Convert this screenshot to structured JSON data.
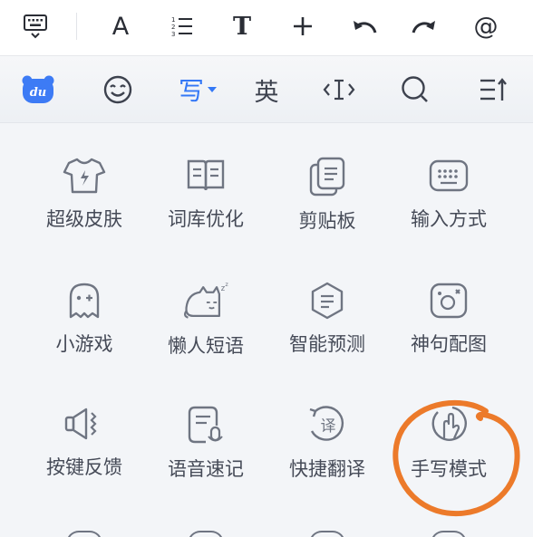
{
  "toolbar": {
    "font_glyph": "A",
    "text_glyph": "T",
    "tools": [
      "keyboard-icon",
      "font-icon",
      "numbered-list-icon",
      "text-icon",
      "add-icon",
      "undo-icon",
      "redo-icon",
      "at-icon"
    ],
    "at_glyph": "@"
  },
  "mode_bar": {
    "handwrite_label": "写",
    "english_label": "英"
  },
  "features": [
    {
      "label": "超级皮肤",
      "icon": "tshirt-icon"
    },
    {
      "label": "词库优化",
      "icon": "book-icon"
    },
    {
      "label": "剪贴板",
      "icon": "clipboard-icon"
    },
    {
      "label": "输入方式",
      "icon": "keyboard-icon"
    },
    {
      "label": "小游戏",
      "icon": "ghost-icon"
    },
    {
      "label": "懒人短语",
      "icon": "sleeping-cat-icon"
    },
    {
      "label": "智能预测",
      "icon": "smart-predict-icon"
    },
    {
      "label": "神句配图",
      "icon": "image-icon"
    },
    {
      "label": "按键反馈",
      "icon": "speaker-vibrate-icon"
    },
    {
      "label": "语音速记",
      "icon": "voice-note-icon"
    },
    {
      "label": "快捷翻译",
      "icon": "translate-icon"
    },
    {
      "label": "手写模式",
      "icon": "handwriting-icon"
    }
  ],
  "colors": {
    "accent": "#3478f6",
    "icon_stroke": "#6f7582",
    "annotation": "#ec7a2a"
  }
}
